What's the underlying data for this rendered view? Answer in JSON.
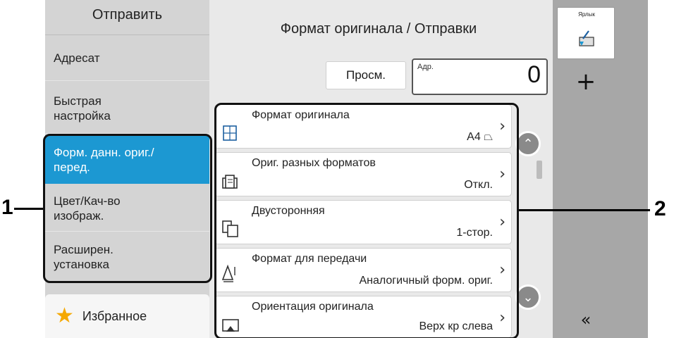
{
  "callouts": {
    "left": "1",
    "right": "2"
  },
  "sidebar": {
    "header": "Отправить",
    "items": [
      {
        "label": "Адресат"
      },
      {
        "label": "Быстрая настройка"
      },
      {
        "label": "Форм. данн. ориг./перед."
      },
      {
        "label": "Цвет/Кач-во изображ."
      },
      {
        "label": "Расширен. установка"
      }
    ],
    "active_index": 2,
    "favorites_label": "Избранное"
  },
  "main": {
    "title": "Формат оригинала / Отправки",
    "view_button": "Просм.",
    "address_label": "Адр.",
    "address_count": "0",
    "rows": [
      {
        "label": "Формат оригинала",
        "value": "A4 ⏢",
        "icon": "original-size-icon"
      },
      {
        "label": "Ориг. разных форматов",
        "value": "Откл.",
        "icon": "mixed-originals-icon"
      },
      {
        "label": "Двусторонняя",
        "value": "1-стор.",
        "icon": "duplex-icon"
      },
      {
        "label": "Формат для передачи",
        "value": "Аналогичный форм. ориг.",
        "icon": "sending-size-icon"
      },
      {
        "label": "Ориентация оригинала",
        "value": "Верх кр слева",
        "icon": "orientation-icon"
      }
    ]
  },
  "right": {
    "shortcut_label": "Ярлык",
    "add_symbol": "+",
    "collapse_symbol": "«"
  },
  "colors": {
    "active": "#1c98d2",
    "sidebar": "#d4d4d4",
    "right_column": "#a7a7a7",
    "favorite_star": "#f5a800"
  }
}
